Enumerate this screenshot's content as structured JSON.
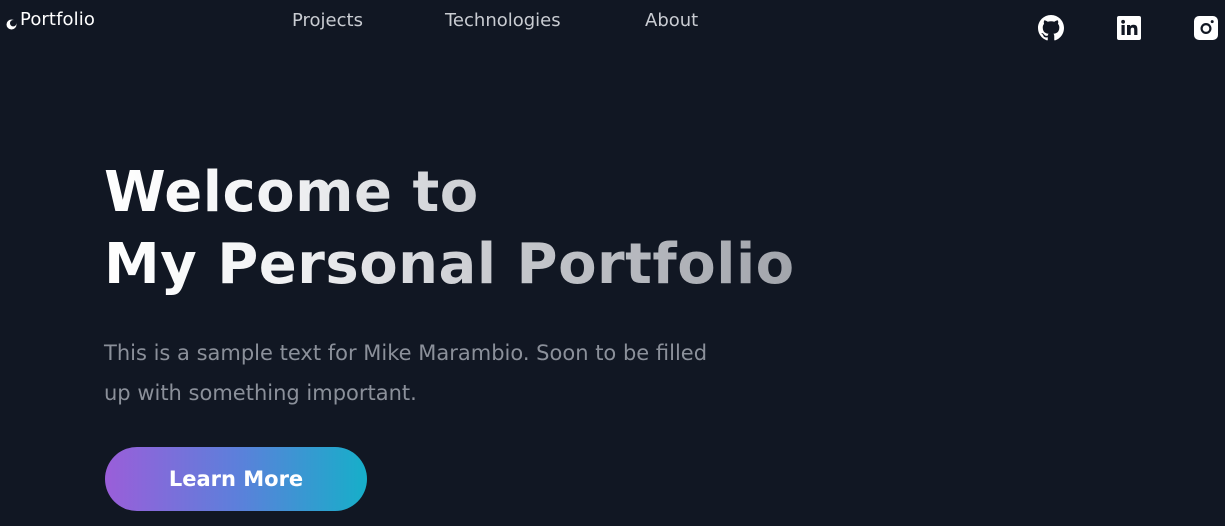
{
  "nav": {
    "brand_label": "Portfolio",
    "brand_icon": "crescent-logo-icon",
    "links": [
      {
        "label": "Projects"
      },
      {
        "label": "Technologies"
      },
      {
        "label": "About"
      }
    ],
    "social": [
      {
        "icon": "github-icon"
      },
      {
        "icon": "linkedin-icon"
      },
      {
        "icon": "instagram-icon"
      }
    ]
  },
  "hero": {
    "title_line1": "Welcome to",
    "title_line2": "My Personal Portfolio",
    "subtitle_line1": "This is a sample text for Mike Marambio. Soon to be filled",
    "subtitle_line2": "up with something important.",
    "cta_label": "Learn More"
  },
  "colors": {
    "background": "#111723",
    "nav_text": "#c9ccd2",
    "subtitle_text": "#8b909a",
    "cta_gradient_start": "#9a5ed9",
    "cta_gradient_end": "#16afc9"
  }
}
